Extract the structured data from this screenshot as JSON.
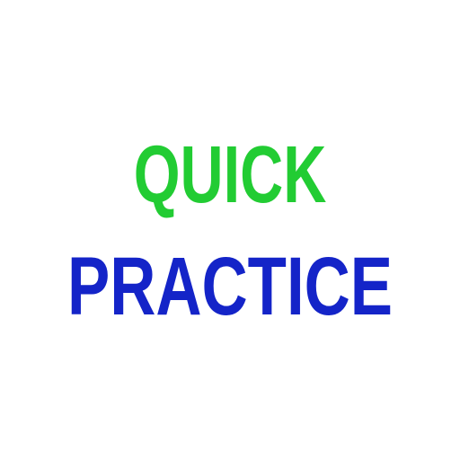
{
  "logo": {
    "line1": "QUICK",
    "line2": "PRACTICE",
    "line1_color": "#22cc33",
    "line2_color": "#1424c8",
    "background_color": "#ffffff"
  }
}
